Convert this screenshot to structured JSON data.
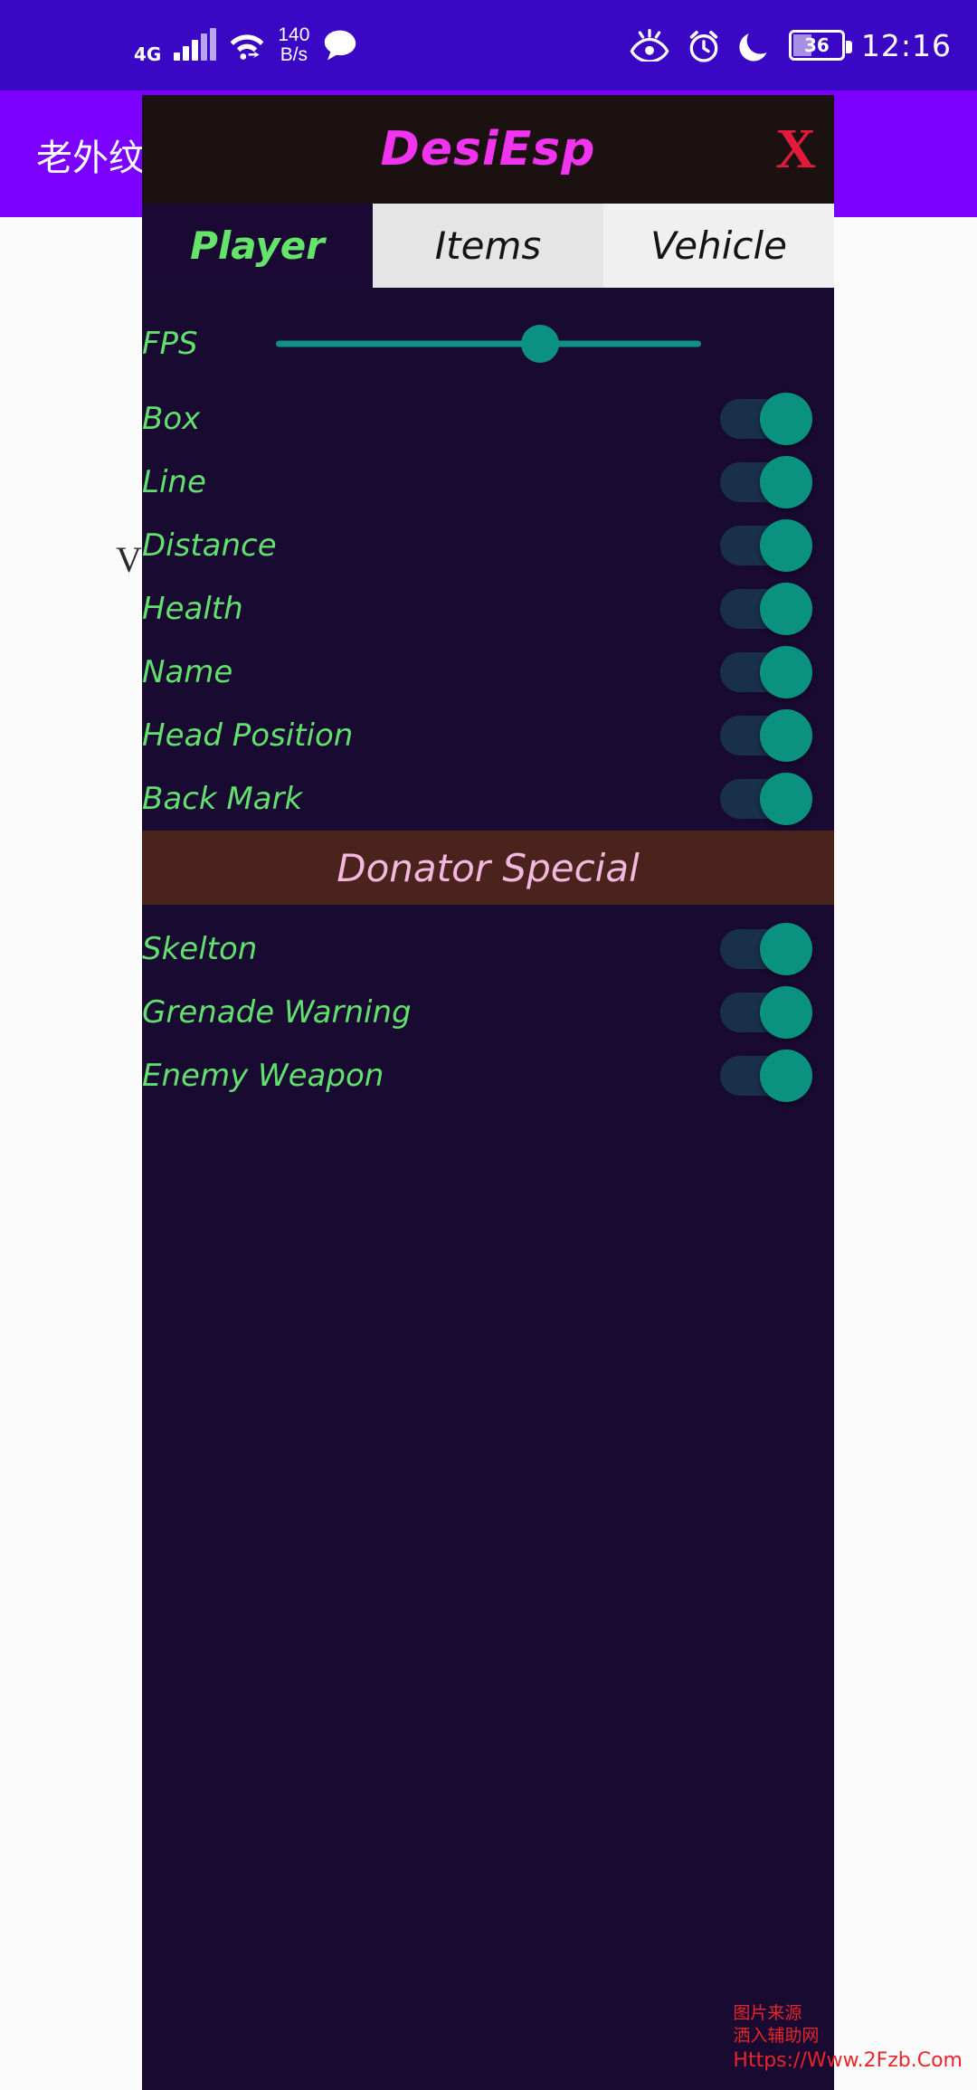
{
  "statusbar": {
    "network_type": "4G",
    "data_speed": "140",
    "data_speed_unit": "B/s",
    "battery_percent": "36",
    "time": "12:16",
    "icons": [
      "signal-bars-icon",
      "wifi-icon",
      "message-bubble-icon",
      "eye-care-icon",
      "alarm-clock-icon",
      "do-not-disturb-moon-icon",
      "battery-icon"
    ]
  },
  "background_app": {
    "text": "老外纹..."
  },
  "stray_mark": "V",
  "overlay": {
    "title": "DesiEsp",
    "close_label": "X",
    "title_color": "#f034f0",
    "close_color": "#e21b3c",
    "tabs": [
      {
        "label": "Player",
        "active": true
      },
      {
        "label": "Items",
        "active": false
      },
      {
        "label": "Vehicle",
        "active": false
      }
    ],
    "slider": {
      "label": "FPS",
      "value_percent": 62,
      "color": "#0d9182"
    },
    "toggles": [
      {
        "label": "Box",
        "on": true
      },
      {
        "label": "Line",
        "on": true
      },
      {
        "label": "Distance",
        "on": true
      },
      {
        "label": "Health",
        "on": true
      },
      {
        "label": "Name",
        "on": true
      },
      {
        "label": "Head Position",
        "on": true
      },
      {
        "label": "Back Mark",
        "on": true
      }
    ],
    "section": {
      "title": "Donator Special",
      "bg_color": "#4a231d",
      "text_color": "#f2b8de"
    },
    "donator_toggles": [
      {
        "label": "Skelton",
        "on": true
      },
      {
        "label": "Grenade Warning",
        "on": true
      },
      {
        "label": "Enemy Weapon",
        "on": true
      }
    ],
    "accent_green": "#62e06d",
    "panel_bg": "#190a32"
  },
  "watermark": {
    "line1": "图片来源",
    "line2": "洒入辅助网",
    "line3": "Https://Www.2Fzb.Com",
    "color": "#e8252b"
  }
}
